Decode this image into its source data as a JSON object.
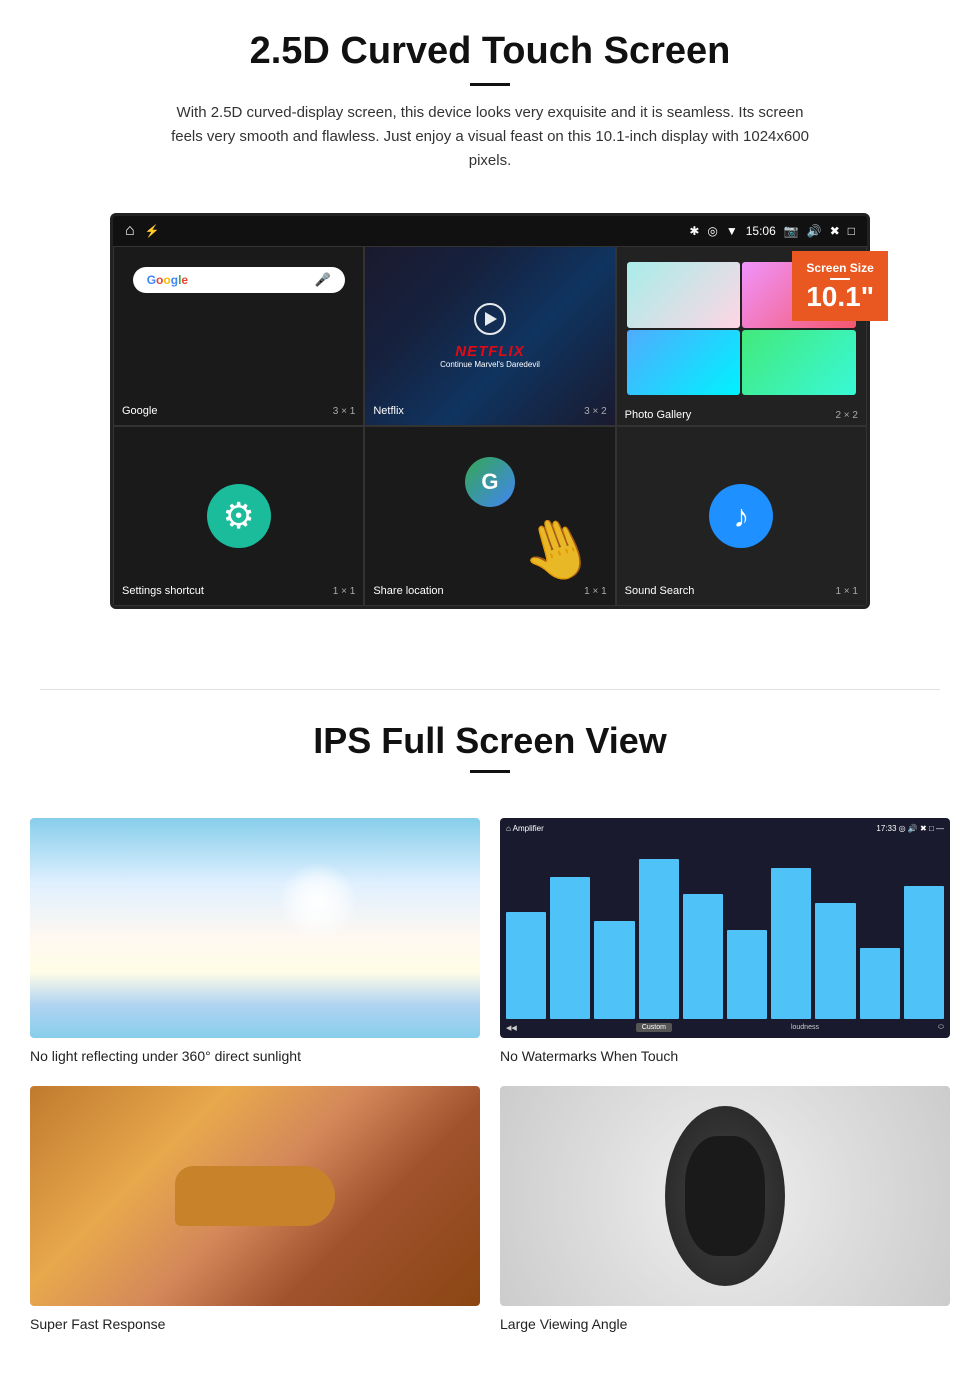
{
  "section1": {
    "title": "2.5D Curved Touch Screen",
    "description": "With 2.5D curved-display screen, this device looks very exquisite and it is seamless. Its screen feels very smooth and flawless. Just enjoy a visual feast on this 10.1-inch display with 1024x600 pixels.",
    "screen_size_badge": {
      "label": "Screen Size",
      "value": "10.1\""
    },
    "statusbar": {
      "time": "15:06"
    },
    "apps": [
      {
        "name": "Google",
        "size": "3 × 1",
        "label": "Google"
      },
      {
        "name": "Netflix",
        "size": "3 × 2",
        "label": "Netflix",
        "sub": "Continue Marvel's Daredevil"
      },
      {
        "name": "Photo Gallery",
        "size": "2 × 2",
        "label": "Photo Gallery"
      },
      {
        "name": "Settings shortcut",
        "size": "1 × 1",
        "label": "Settings shortcut"
      },
      {
        "name": "Share location",
        "size": "1 × 1",
        "label": "Share location"
      },
      {
        "name": "Sound Search",
        "size": "1 × 1",
        "label": "Sound Search"
      }
    ]
  },
  "section2": {
    "title": "IPS Full Screen View",
    "features": [
      {
        "label": "No light reflecting under 360° direct sunlight",
        "image_type": "sunlight"
      },
      {
        "label": "No Watermarks When Touch",
        "image_type": "amplifier"
      },
      {
        "label": "Super Fast Response",
        "image_type": "cheetah"
      },
      {
        "label": "Large Viewing Angle",
        "image_type": "car"
      }
    ]
  }
}
